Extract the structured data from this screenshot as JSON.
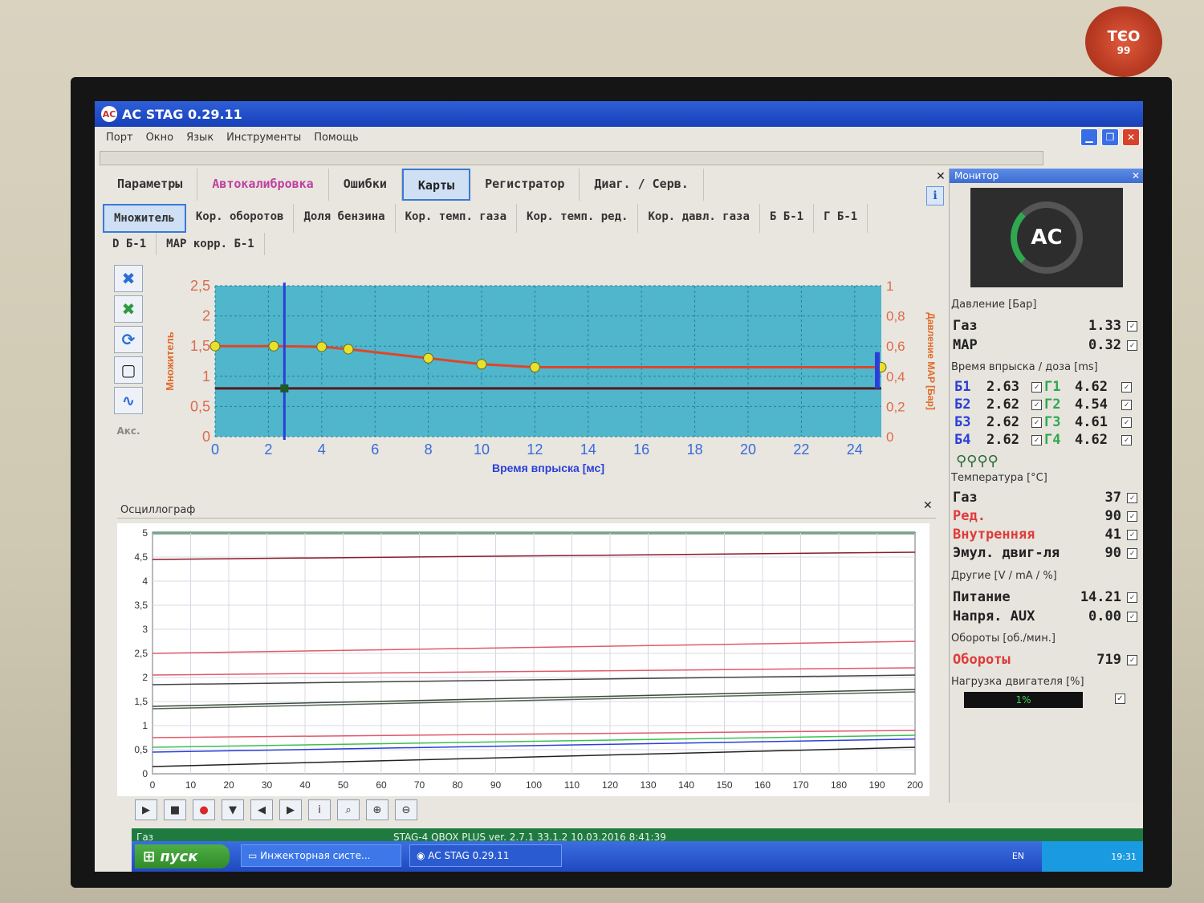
{
  "badge": {
    "top": "TЄO",
    "bottom": "99"
  },
  "window": {
    "title": "AC STAG 0.29.11"
  },
  "menu": [
    "Порт",
    "Окно",
    "Язык",
    "Инструменты",
    "Помощь"
  ],
  "tabs_main": [
    {
      "label": "Параметры",
      "active": false
    },
    {
      "label": "Автокалибровка",
      "active": false
    },
    {
      "label": "Ошибки",
      "active": false
    },
    {
      "label": "Карты",
      "active": true
    },
    {
      "label": "Регистратор",
      "active": false
    },
    {
      "label": "Диаг. / Серв.",
      "active": false
    }
  ],
  "tabs_sub": [
    {
      "label": "Множитель",
      "active": true
    },
    {
      "label": "Кор. оборотов",
      "active": false
    },
    {
      "label": "Доля бензина",
      "active": false
    },
    {
      "label": "Кор. темп. газа",
      "active": false
    },
    {
      "label": "Кор. темп. ред.",
      "active": false
    },
    {
      "label": "Кор. давл. газа",
      "active": false
    },
    {
      "label": "Б Б-1",
      "active": false
    },
    {
      "label": "Г Б-1",
      "active": false
    }
  ],
  "tabs_sub2": [
    {
      "label": "D Б-1"
    },
    {
      "label": "MAP корр. Б-1"
    }
  ],
  "tools": {
    "akc_label": "Акс."
  },
  "chart_data": [
    {
      "type": "line",
      "xlabel": "Время впрыска [мс]",
      "ylabel": "Множитель",
      "y2label": "Давление MAP [Бар]",
      "xlim": [
        0,
        25
      ],
      "ylim": [
        0,
        2.5
      ],
      "y2lim": [
        0,
        1
      ],
      "x_ticks": [
        0,
        2,
        4,
        6,
        8,
        10,
        12,
        14,
        16,
        18,
        20,
        22,
        24
      ],
      "y_ticks": [
        "0",
        "0,5",
        "1",
        "1,5",
        "2",
        "2,5"
      ],
      "y2_ticks": [
        "0",
        "0,2",
        "0,4",
        "0,6",
        "0,8",
        "1"
      ],
      "series": [
        {
          "points": [
            [
              0,
              1.5
            ],
            [
              2.2,
              1.5
            ],
            [
              4,
              1.49
            ],
            [
              5,
              1.45
            ],
            [
              8,
              1.3
            ],
            [
              10,
              1.2
            ],
            [
              12,
              1.15
            ],
            [
              25,
              1.15
            ]
          ]
        }
      ],
      "map_line_value": 0.8,
      "cursor_x": 2.6,
      "colors": {
        "curve": "#e0452a",
        "point": "#e8e02a",
        "map_line": "#5a1a1a",
        "cursor": "#2a3fd8",
        "plot_bg": "#4fb6cc"
      }
    },
    {
      "type": "line",
      "title": "Осциллограф",
      "xlim": [
        0,
        200
      ],
      "ylim": [
        0,
        5
      ],
      "x_ticks": [
        0,
        10,
        20,
        30,
        40,
        50,
        60,
        70,
        80,
        90,
        100,
        110,
        120,
        130,
        140,
        150,
        160,
        170,
        180,
        190,
        200
      ],
      "y_ticks": [
        "0",
        "0,5",
        "1",
        "1,5",
        "2",
        "2,5",
        "3",
        "3,5",
        "4",
        "4,5",
        "5"
      ],
      "series": [
        {
          "color": "#8b1c2a",
          "values_start": 4.45,
          "values_end": 4.6
        },
        {
          "color": "#e05a6a",
          "values_start": 2.5,
          "values_end": 2.75
        },
        {
          "color": "#e05a6a",
          "values_start": 2.05,
          "values_end": 2.2
        },
        {
          "color": "#444444",
          "values_start": 1.85,
          "values_end": 2.05
        },
        {
          "color": "#3a4a3a",
          "values_start": 1.4,
          "values_end": 1.75
        },
        {
          "color": "#556655",
          "values_start": 1.35,
          "values_end": 1.7
        },
        {
          "color": "#e05a6a",
          "values_start": 0.75,
          "values_end": 0.9
        },
        {
          "color": "#3ac050",
          "values_start": 0.55,
          "values_end": 0.8
        },
        {
          "color": "#2a3fd8",
          "values_start": 0.45,
          "values_end": 0.72
        },
        {
          "color": "#222222",
          "values_start": 0.15,
          "values_end": 0.55
        }
      ]
    }
  ],
  "monitor": {
    "title": "Монитор",
    "pressure": {
      "header": "Давление [Бар]",
      "rows": [
        {
          "label": "Газ",
          "value": "1.33"
        },
        {
          "label": "MAP",
          "value": "0.32"
        }
      ]
    },
    "injection": {
      "header": "Время впрыска / доза [ms]",
      "rows": [
        {
          "b": "Б1",
          "bv": "2.63",
          "g": "Г1",
          "gv": "4.62"
        },
        {
          "b": "Б2",
          "bv": "2.62",
          "g": "Г2",
          "gv": "4.54"
        },
        {
          "b": "Б3",
          "bv": "2.62",
          "g": "Г3",
          "gv": "4.61"
        },
        {
          "b": "Б4",
          "bv": "2.62",
          "g": "Г4",
          "gv": "4.62"
        }
      ]
    },
    "temperature": {
      "header": "Температура [°C]",
      "rows": [
        {
          "label": "Газ",
          "value": "37",
          "color": "#222222"
        },
        {
          "label": "Ред.",
          "value": "90",
          "color": "#e03a3a"
        },
        {
          "label": "Внутренняя",
          "value": "41",
          "color": "#e03a3a"
        },
        {
          "label": "Эмул. двиг-ля",
          "value": "90",
          "color": "#222222"
        }
      ]
    },
    "other": {
      "header": "Другие [V / mA / %]",
      "rows": [
        {
          "label": "Питание",
          "value": "14.21"
        },
        {
          "label": "Напря. AUX",
          "value": "0.00"
        }
      ]
    },
    "rpm": {
      "header": "Обороты [об./мин.]",
      "label": "Обороты",
      "value": "719"
    },
    "load": {
      "header": "Нагрузка двигателя [%]",
      "value": "1%",
      "fraction": 0.01
    }
  },
  "statusbar": {
    "left": "Газ",
    "device": "STAG-4 QBOX PLUS  ver. 2.7.1  33.1.2  10.03.2016 8:41:39"
  },
  "taskbar": {
    "start": "пуск",
    "tasks": [
      "Инжекторная систе...",
      "AC STAG 0.29.11"
    ],
    "lang": "EN",
    "clock": "19:31"
  }
}
